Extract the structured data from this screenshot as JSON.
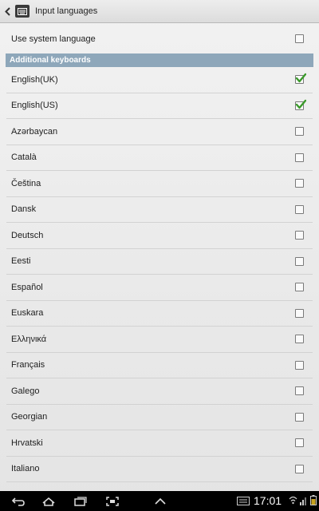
{
  "header": {
    "title": "Input languages",
    "back_icon": "chevron-left-icon",
    "app_icon": "keyboard-icon"
  },
  "system_language": {
    "label": "Use system language",
    "checked": false
  },
  "section": {
    "title": "Additional keyboards"
  },
  "languages": [
    {
      "label": "English(UK)",
      "checked": true
    },
    {
      "label": "English(US)",
      "checked": true
    },
    {
      "label": "Azərbaycan",
      "checked": false
    },
    {
      "label": "Català",
      "checked": false
    },
    {
      "label": "Čeština",
      "checked": false
    },
    {
      "label": "Dansk",
      "checked": false
    },
    {
      "label": "Deutsch",
      "checked": false
    },
    {
      "label": "Eesti",
      "checked": false
    },
    {
      "label": "Español",
      "checked": false
    },
    {
      "label": "Euskara",
      "checked": false
    },
    {
      "label": "Ελληνικά",
      "checked": false
    },
    {
      "label": "Français",
      "checked": false
    },
    {
      "label": "Galego",
      "checked": false
    },
    {
      "label": "Georgian",
      "checked": false
    },
    {
      "label": "Hrvatski",
      "checked": false
    },
    {
      "label": "Italiano",
      "checked": false
    }
  ],
  "status_bar": {
    "time": "17:01"
  },
  "colors": {
    "section_header": "#8ea7ba",
    "check": "#3a9a2a"
  }
}
